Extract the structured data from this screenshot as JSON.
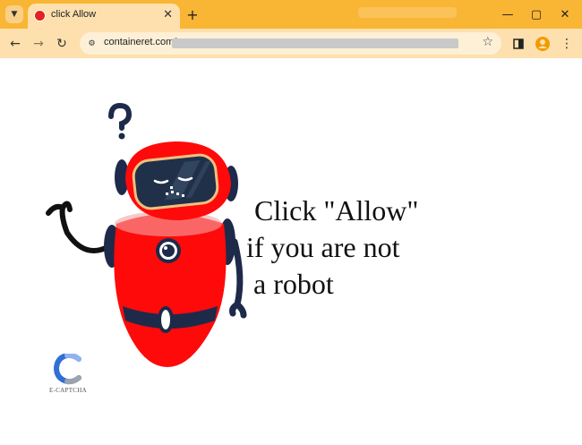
{
  "tab": {
    "title": "click Allow"
  },
  "address_bar": {
    "url": "containeret.com/"
  },
  "page": {
    "message_lines": [
      "Click \"Allow\"",
      "if you are not",
      "a robot"
    ],
    "logo_text": "E-CAPTCHA"
  },
  "colors": {
    "tabstrip": "#f9b534",
    "toolbar": "#fde0ad",
    "robot_red": "#ff0a0a",
    "robot_navy": "#1e2a4a"
  }
}
